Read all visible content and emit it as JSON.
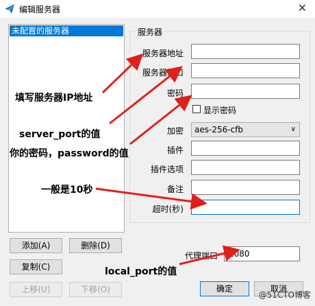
{
  "window": {
    "title": "编辑服务器",
    "close_glyph": "✕"
  },
  "server_list": {
    "items": [
      "未配置的服务器"
    ]
  },
  "group": {
    "title": "服务器"
  },
  "labels": {
    "server_addr": "服务器地址",
    "server_port": "服务器端口",
    "password": "密码",
    "show_password": "显示密码",
    "encryption": "加密",
    "plugin": "插件",
    "plugin_options": "插件选项",
    "remarks": "备注",
    "timeout": "超时(秒)",
    "proxy_port": "代理端口"
  },
  "values": {
    "server_addr": "",
    "server_port": "",
    "password": "",
    "encryption": "aes-256-cfb",
    "plugin": "",
    "plugin_options": "",
    "remarks": "",
    "timeout": "",
    "proxy_port": "1080"
  },
  "buttons": {
    "add": "添加(A)",
    "delete": "删除(D)",
    "copy": "复制(C)",
    "move_up": "上移(U)",
    "move_down": "下移(O)",
    "ok": "确定",
    "cancel": "取消"
  },
  "annotations": {
    "ip": "填写服务器IP地址",
    "port": "server_port的值",
    "password": "你的密码，password的值",
    "timeout": "一般是10秒",
    "local_port": "local_port的值"
  },
  "watermark": "@51CTO博客",
  "colors": {
    "accent": "#0078d7",
    "arrow": "#e0201b"
  }
}
